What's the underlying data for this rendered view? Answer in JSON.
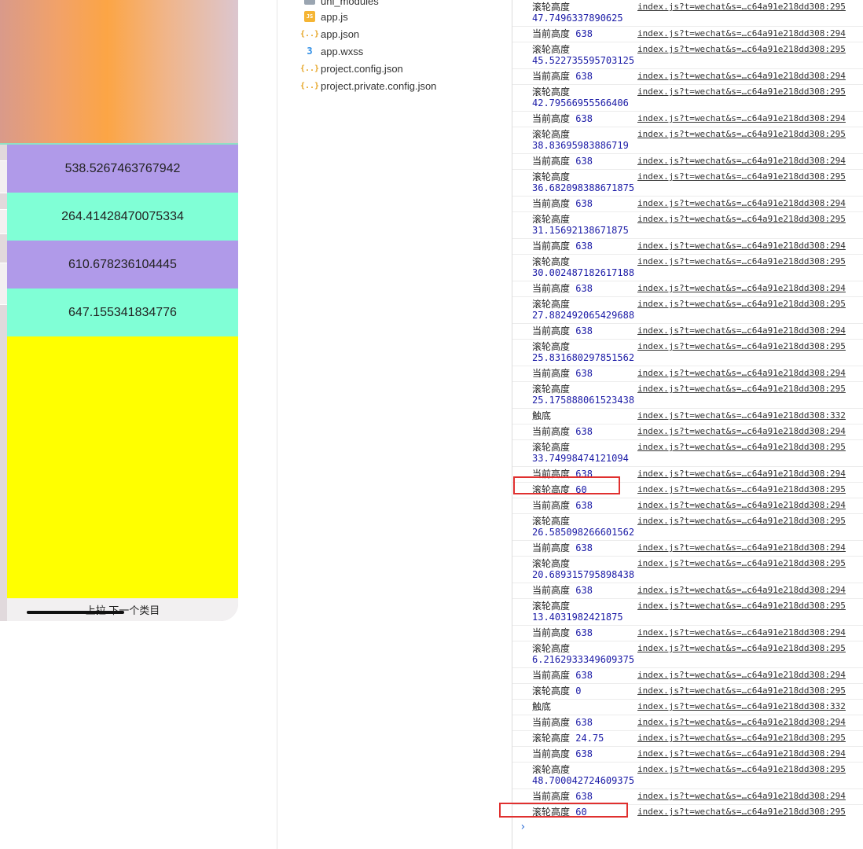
{
  "simulator": {
    "items": [
      {
        "value": "538.5267463767942",
        "color": "#b09ae9"
      },
      {
        "value": "264.41428470075334",
        "color": "#80ffd6"
      },
      {
        "value": "610.678236104445",
        "color": "#b09ae9"
      },
      {
        "value": "647.155341834776",
        "color": "#80ffd6"
      }
    ],
    "filler_color": "#ffff00",
    "footer_text": "上拉 下一个类目"
  },
  "file_tree": {
    "folder": "uni_modules",
    "files": [
      {
        "name": "app.js",
        "icon": "js-file-icon"
      },
      {
        "name": "app.json",
        "icon": "json-file-icon"
      },
      {
        "name": "app.wxss",
        "icon": "wxss-file-icon"
      },
      {
        "name": "project.config.json",
        "icon": "json-file-icon"
      },
      {
        "name": "project.private.config.json",
        "icon": "json-file-icon"
      }
    ]
  },
  "console": {
    "label_height": "当前高度",
    "label_scroll": "滚轮高度",
    "label_bottom": "触底",
    "src_294": "index.js?t=wechat&s=…c64a91e218dd308:294",
    "src_295": "index.js?t=wechat&s=…c64a91e218dd308:295",
    "src_332": "index.js?t=wechat&s=…c64a91e218dd308:332",
    "logs": [
      {
        "label": "滚轮高度",
        "value": "47.7496337890625",
        "wrap": true,
        "src": "index.js?t=wechat&s=…c64a91e218dd308:295"
      },
      {
        "label": "当前高度",
        "value": "638",
        "wrap": false,
        "src": "index.js?t=wechat&s=…c64a91e218dd308:294"
      },
      {
        "label": "滚轮高度",
        "value": "45.522735595703125",
        "wrap": true,
        "src": "index.js?t=wechat&s=…c64a91e218dd308:295"
      },
      {
        "label": "当前高度",
        "value": "638",
        "wrap": false,
        "src": "index.js?t=wechat&s=…c64a91e218dd308:294"
      },
      {
        "label": "滚轮高度",
        "value": "42.79566955566406",
        "wrap": true,
        "src": "index.js?t=wechat&s=…c64a91e218dd308:295"
      },
      {
        "label": "当前高度",
        "value": "638",
        "wrap": false,
        "src": "index.js?t=wechat&s=…c64a91e218dd308:294"
      },
      {
        "label": "滚轮高度",
        "value": "38.83695983886719",
        "wrap": true,
        "src": "index.js?t=wechat&s=…c64a91e218dd308:295"
      },
      {
        "label": "当前高度",
        "value": "638",
        "wrap": false,
        "src": "index.js?t=wechat&s=…c64a91e218dd308:294"
      },
      {
        "label": "滚轮高度",
        "value": "36.682098388671875",
        "wrap": true,
        "src": "index.js?t=wechat&s=…c64a91e218dd308:295"
      },
      {
        "label": "当前高度",
        "value": "638",
        "wrap": false,
        "src": "index.js?t=wechat&s=…c64a91e218dd308:294"
      },
      {
        "label": "滚轮高度",
        "value": "31.15692138671875",
        "wrap": true,
        "src": "index.js?t=wechat&s=…c64a91e218dd308:295"
      },
      {
        "label": "当前高度",
        "value": "638",
        "wrap": false,
        "src": "index.js?t=wechat&s=…c64a91e218dd308:294"
      },
      {
        "label": "滚轮高度",
        "value": "30.002487182617188",
        "wrap": true,
        "src": "index.js?t=wechat&s=…c64a91e218dd308:295"
      },
      {
        "label": "当前高度",
        "value": "638",
        "wrap": false,
        "src": "index.js?t=wechat&s=…c64a91e218dd308:294"
      },
      {
        "label": "滚轮高度",
        "value": "27.882492065429688",
        "wrap": true,
        "src": "index.js?t=wechat&s=…c64a91e218dd308:295"
      },
      {
        "label": "当前高度",
        "value": "638",
        "wrap": false,
        "src": "index.js?t=wechat&s=…c64a91e218dd308:294"
      },
      {
        "label": "滚轮高度",
        "value": "25.831680297851562",
        "wrap": true,
        "src": "index.js?t=wechat&s=…c64a91e218dd308:295"
      },
      {
        "label": "当前高度",
        "value": "638",
        "wrap": false,
        "src": "index.js?t=wechat&s=…c64a91e218dd308:294"
      },
      {
        "label": "滚轮高度",
        "value": "25.175888061523438",
        "wrap": true,
        "src": "index.js?t=wechat&s=…c64a91e218dd308:295"
      },
      {
        "label": "触底",
        "value": "",
        "wrap": false,
        "src": "index.js?t=wechat&s=…c64a91e218dd308:332"
      },
      {
        "label": "当前高度",
        "value": "638",
        "wrap": false,
        "src": "index.js?t=wechat&s=…c64a91e218dd308:294"
      },
      {
        "label": "滚轮高度",
        "value": "33.74998474121094",
        "wrap": true,
        "src": "index.js?t=wechat&s=…c64a91e218dd308:295"
      },
      {
        "label": "当前高度",
        "value": "638",
        "wrap": false,
        "src": "index.js?t=wechat&s=…c64a91e218dd308:294"
      },
      {
        "label": "滚轮高度",
        "value": "60",
        "wrap": false,
        "src": "index.js?t=wechat&s=…c64a91e218dd308:295",
        "highlight": true
      },
      {
        "label": "当前高度",
        "value": "638",
        "wrap": false,
        "src": "index.js?t=wechat&s=…c64a91e218dd308:294"
      },
      {
        "label": "滚轮高度",
        "value": "26.585098266601562",
        "wrap": true,
        "src": "index.js?t=wechat&s=…c64a91e218dd308:295"
      },
      {
        "label": "当前高度",
        "value": "638",
        "wrap": false,
        "src": "index.js?t=wechat&s=…c64a91e218dd308:294"
      },
      {
        "label": "滚轮高度",
        "value": "20.689315795898438",
        "wrap": true,
        "src": "index.js?t=wechat&s=…c64a91e218dd308:295"
      },
      {
        "label": "当前高度",
        "value": "638",
        "wrap": false,
        "src": "index.js?t=wechat&s=…c64a91e218dd308:294"
      },
      {
        "label": "滚轮高度",
        "value": "13.4031982421875",
        "wrap": true,
        "src": "index.js?t=wechat&s=…c64a91e218dd308:295"
      },
      {
        "label": "当前高度",
        "value": "638",
        "wrap": false,
        "src": "index.js?t=wechat&s=…c64a91e218dd308:294"
      },
      {
        "label": "滚轮高度",
        "value": "6.2162933349609375",
        "wrap": true,
        "src": "index.js?t=wechat&s=…c64a91e218dd308:295"
      },
      {
        "label": "当前高度",
        "value": "638",
        "wrap": false,
        "src": "index.js?t=wechat&s=…c64a91e218dd308:294"
      },
      {
        "label": "滚轮高度",
        "value": "0",
        "wrap": false,
        "src": "index.js?t=wechat&s=…c64a91e218dd308:295"
      },
      {
        "label": "触底",
        "value": "",
        "wrap": false,
        "src": "index.js?t=wechat&s=…c64a91e218dd308:332"
      },
      {
        "label": "当前高度",
        "value": "638",
        "wrap": false,
        "src": "index.js?t=wechat&s=…c64a91e218dd308:294"
      },
      {
        "label": "滚轮高度",
        "value": "24.75",
        "wrap": false,
        "src": "index.js?t=wechat&s=…c64a91e218dd308:295"
      },
      {
        "label": "当前高度",
        "value": "638",
        "wrap": false,
        "src": "index.js?t=wechat&s=…c64a91e218dd308:294"
      },
      {
        "label": "滚轮高度",
        "value": "48.700042724609375",
        "wrap": true,
        "src": "index.js?t=wechat&s=…c64a91e218dd308:295"
      },
      {
        "label": "当前高度",
        "value": "638",
        "wrap": false,
        "src": "index.js?t=wechat&s=…c64a91e218dd308:294"
      },
      {
        "label": "滚轮高度",
        "value": "60",
        "wrap": false,
        "src": "index.js?t=wechat&s=…c64a91e218dd308:295",
        "highlight": true
      }
    ],
    "prompt_symbol": "›",
    "highlight_color": "#e0302f"
  }
}
